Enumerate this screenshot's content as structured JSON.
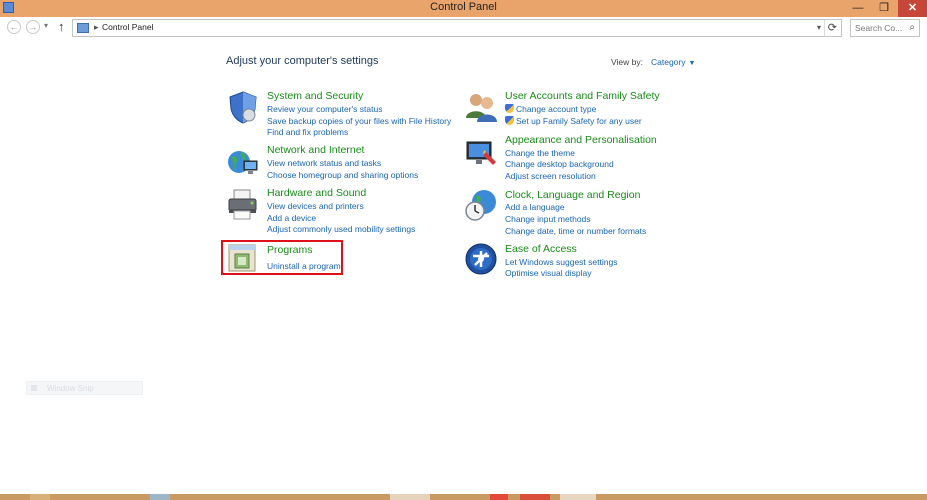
{
  "window": {
    "title": "Control Panel",
    "minimize": "—",
    "maximize": "❐",
    "close": "✕"
  },
  "nav": {
    "back": "←",
    "forward": "→",
    "recent": "▾",
    "up": "↑",
    "breadcrumb_sep": "▸",
    "breadcrumb": "Control Panel",
    "dropdown": "▾",
    "refresh": "⟳",
    "search_placeholder": "Search Co...",
    "search_icon": "⌕"
  },
  "main": {
    "heading": "Adjust your computer's settings",
    "view_by_label": "View by:",
    "view_by_value": "Category",
    "view_by_arrow": "▼"
  },
  "categories_left": [
    {
      "title": "System and Security",
      "links": [
        "Review your computer's status",
        "Save backup copies of your files with File History",
        "Find and fix problems"
      ]
    },
    {
      "title": "Network and Internet",
      "links": [
        "View network status and tasks",
        "Choose homegroup and sharing options"
      ]
    },
    {
      "title": "Hardware and Sound",
      "links": [
        "View devices and printers",
        "Add a device",
        "Adjust commonly used mobility settings"
      ]
    },
    {
      "title": "Programs",
      "links": [
        "Uninstall a program"
      ]
    }
  ],
  "categories_right": [
    {
      "title": "User Accounts and Family Safety",
      "links": [
        "Change account type",
        "Set up Family Safety for any user"
      ]
    },
    {
      "title": "Appearance and Personalisation",
      "links": [
        "Change the theme",
        "Change desktop background",
        "Adjust screen resolution"
      ]
    },
    {
      "title": "Clock, Language and Region",
      "links": [
        "Add a language",
        "Change input methods",
        "Change date, time or number formats"
      ]
    },
    {
      "title": "Ease of Access",
      "links": [
        "Let Windows suggest settings",
        "Optimise visual display"
      ]
    }
  ],
  "snap": {
    "label": "Window Snip"
  },
  "colors": {
    "link": "#1a64b4",
    "category_title": "#1a8a1a",
    "titlebar": "#e8a46a",
    "highlight": "#e0101b"
  }
}
